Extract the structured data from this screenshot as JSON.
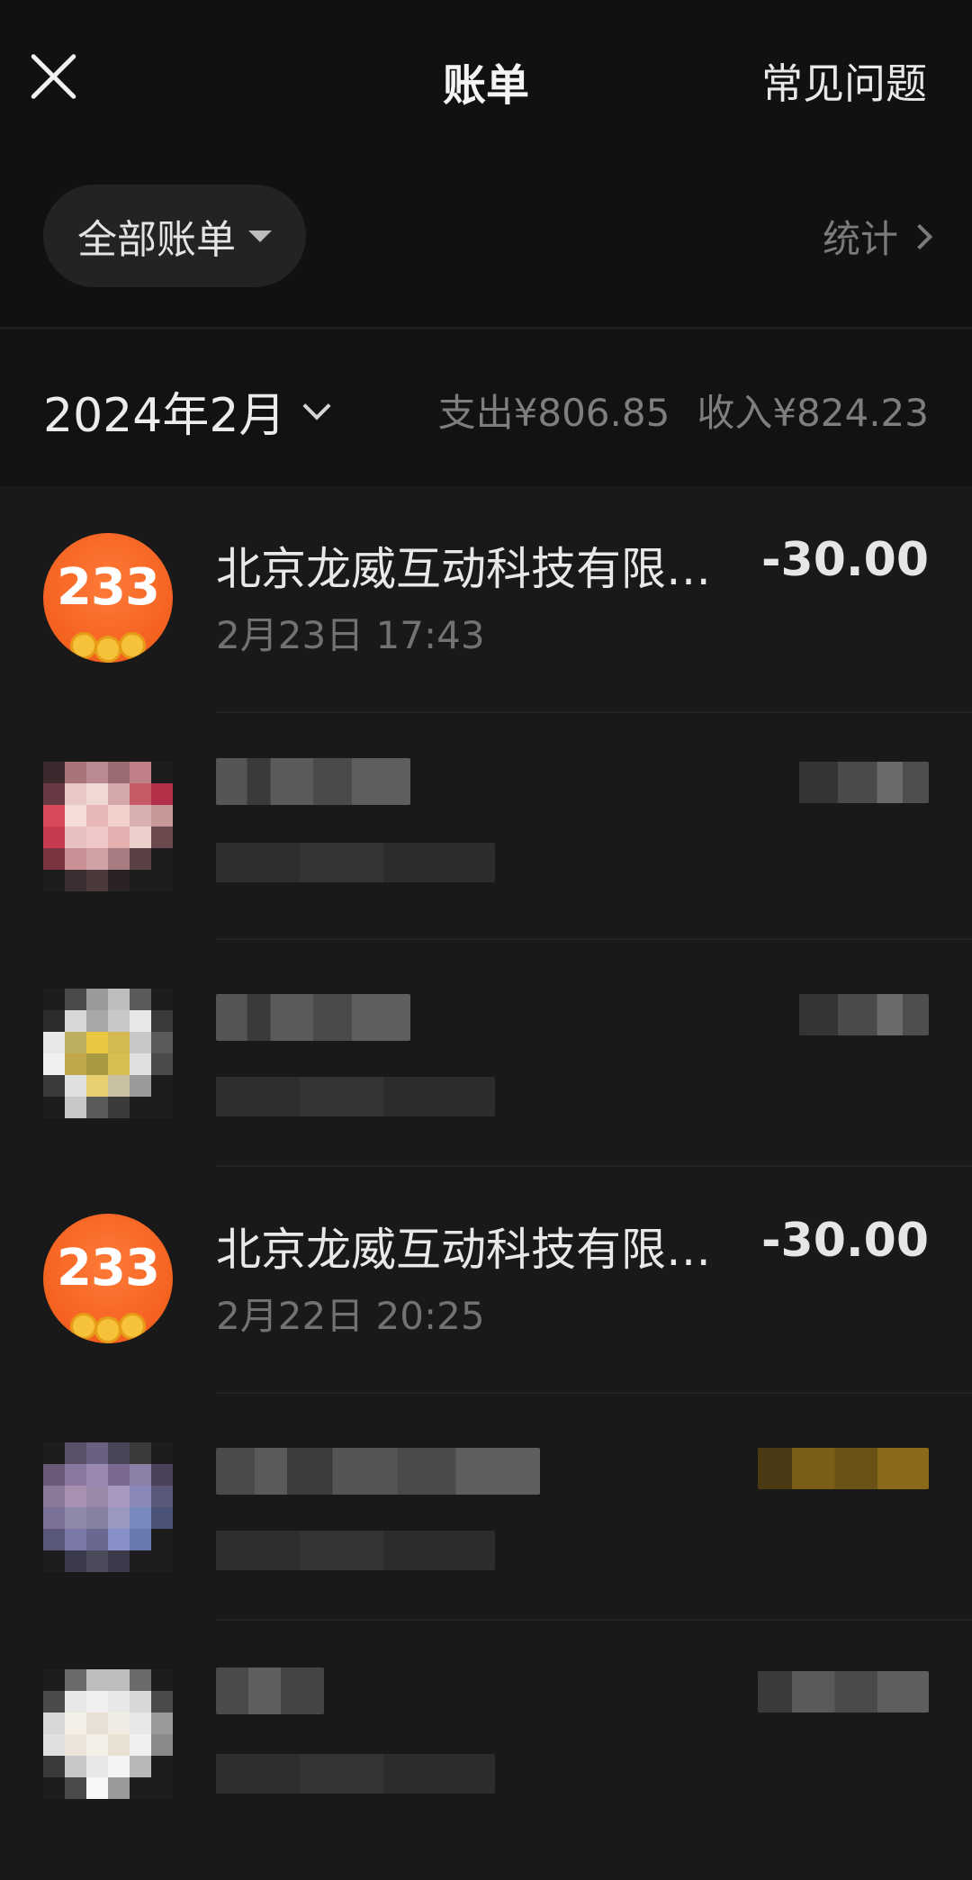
{
  "header": {
    "title": "账单",
    "faq_label": "常见问题"
  },
  "filter": {
    "selected": "全部账单",
    "stats_label": "统计"
  },
  "month_bar": {
    "month_label": "2024年2月",
    "expense_label": "支出¥806.85",
    "income_label": "收入¥824.23"
  },
  "transactions": [
    {
      "name": "北京龙威互动科技有限公司",
      "time": "2月23日 17:43",
      "amount": "-30.00",
      "avatar_text": "233",
      "avatar_color": "#f4611f"
    },
    {
      "obscured": true
    },
    {
      "obscured": true
    },
    {
      "name": "北京龙威互动科技有限公司",
      "time": "2月22日 20:25",
      "amount": "-30.00",
      "avatar_text": "233",
      "avatar_color": "#f4611f"
    },
    {
      "obscured": true
    },
    {
      "obscured": true
    }
  ],
  "icons": {
    "close": "close-icon",
    "dropdown": "caret-down-icon",
    "stats_chevron": "chevron-right-icon",
    "month_chevron": "chevron-down-icon"
  }
}
